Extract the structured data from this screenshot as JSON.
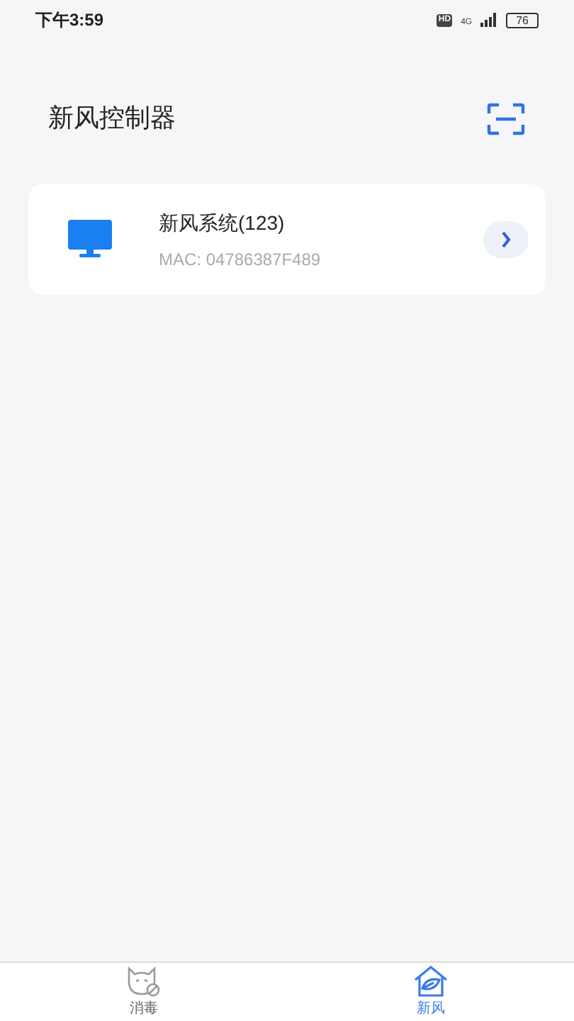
{
  "status_bar": {
    "time": "下午3:59",
    "hd": "HD",
    "network": "4G",
    "battery": "76"
  },
  "header": {
    "title": "新风控制器"
  },
  "devices": [
    {
      "name": "新风系统(123)",
      "mac": "MAC: 04786387F489"
    }
  ],
  "tabs": [
    {
      "label": "消毒",
      "kind": "disinfect",
      "selected": false
    },
    {
      "label": "新风",
      "kind": "fresh-air",
      "selected": true
    }
  ]
}
